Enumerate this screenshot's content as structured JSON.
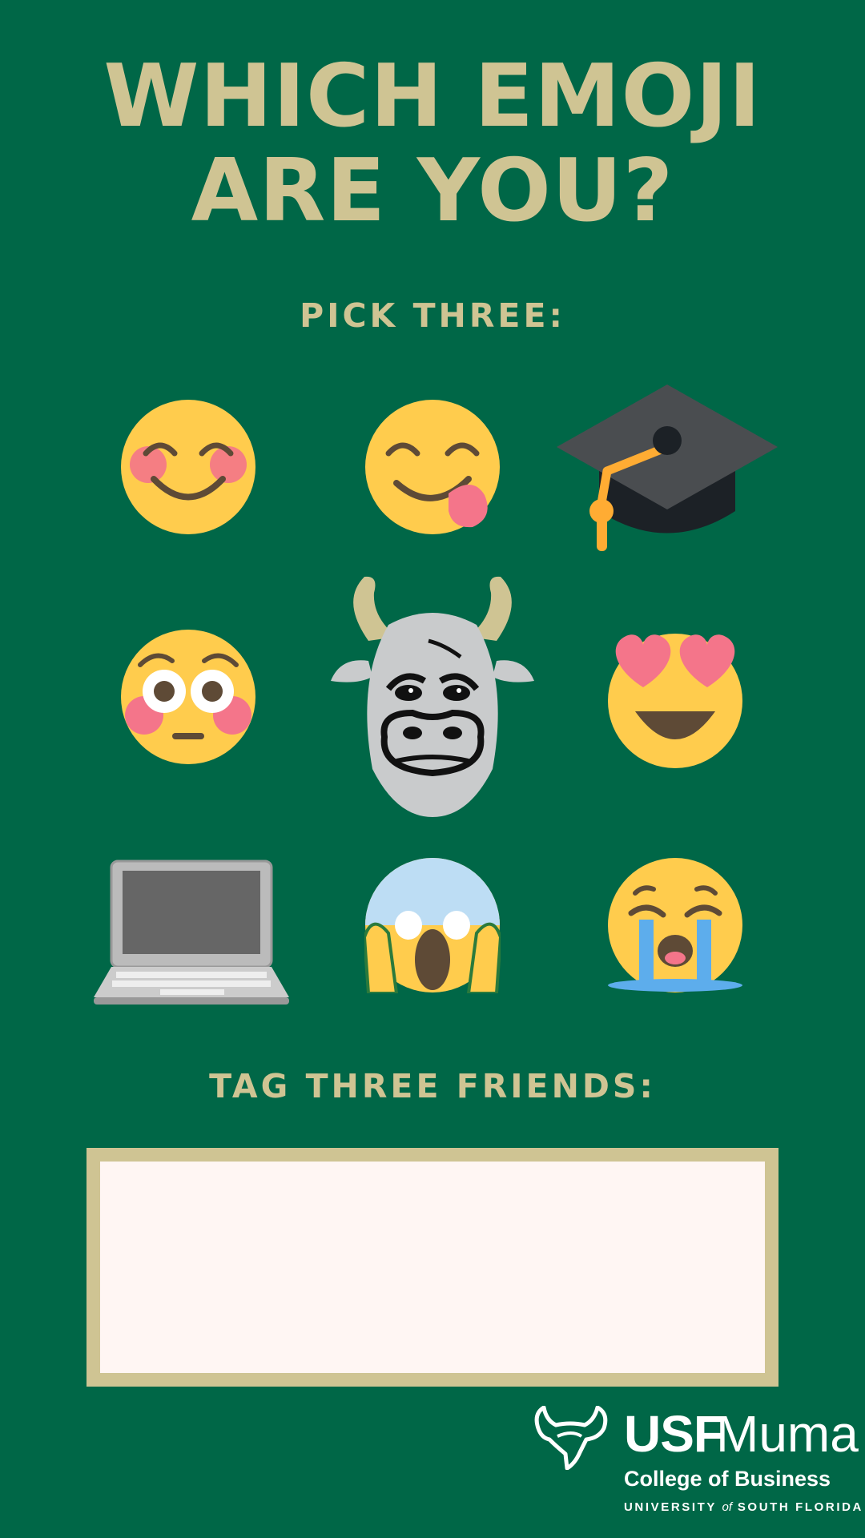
{
  "title": {
    "line1": "WHICH EMOJI",
    "line2": "ARE YOU?"
  },
  "pick_label": "PICK THREE:",
  "tag_label": "TAG THREE FRIENDS:",
  "emojis": [
    "smiling-face-with-smiling-eyes-icon",
    "face-savoring-food-icon",
    "graduation-cap-icon",
    "flushed-face-icon",
    "usf-bull-mascot-icon",
    "smiling-face-with-heart-eyes-icon",
    "laptop-icon",
    "face-screaming-in-fear-icon",
    "loudly-crying-face-icon"
  ],
  "logo": {
    "usf": "USF",
    "muma": "Muma",
    "college": "College of Business",
    "university_part1": "UNIVERSITY",
    "university_of": "of",
    "university_part2": "SOUTH FLORIDA"
  },
  "colors": {
    "background": "#006747",
    "gold": "#CFC493",
    "emoji_yellow": "#FFCC4D",
    "blush": "#F4758A",
    "box_fill": "#FFF6F3"
  }
}
